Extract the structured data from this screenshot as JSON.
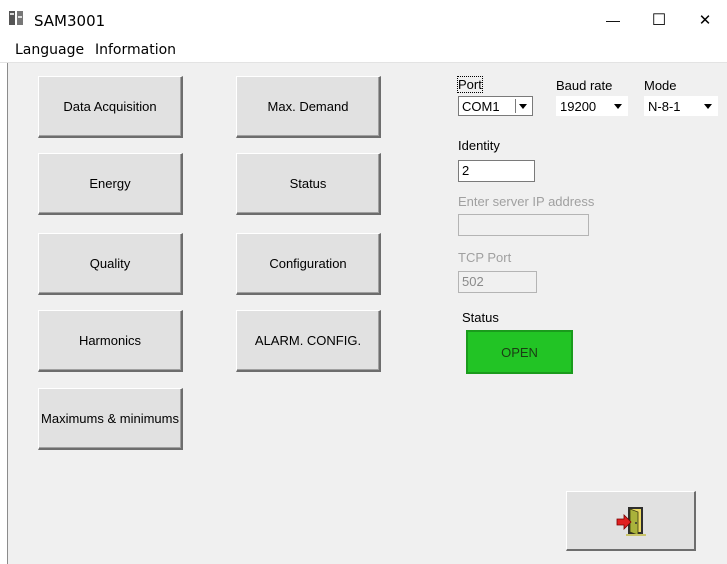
{
  "window": {
    "title": "SAM3001",
    "minimize_glyph": "—",
    "maximize_glyph": "☐",
    "close_glyph": "✕"
  },
  "menu": {
    "items": [
      {
        "label": "Language"
      },
      {
        "label": "Information"
      }
    ]
  },
  "buttons": {
    "left_column": [
      {
        "label": "Data Acquisition"
      },
      {
        "label": "Energy"
      },
      {
        "label": "Quality"
      },
      {
        "label": "Harmonics"
      },
      {
        "label": "Maximums & minimums"
      }
    ],
    "middle_column": [
      {
        "label": "Max. Demand"
      },
      {
        "label": "Status"
      },
      {
        "label": "Configuration"
      },
      {
        "label": "ALARM. CONFIG."
      }
    ],
    "exit_icon": "exit-door-icon"
  },
  "connection": {
    "port_label": "Port",
    "port_value": "COM1",
    "baud_label": "Baud rate",
    "baud_value": "19200",
    "mode_label": "Mode",
    "mode_value": "N-8-1",
    "identity_label": "Identity",
    "identity_value": "2",
    "ip_label": "Enter server IP address",
    "ip_value": "",
    "tcp_label": "TCP Port",
    "tcp_value": "502",
    "status_label": "Status",
    "status_value": "OPEN"
  },
  "colors": {
    "status_open": "#22c425",
    "window_bg": "#f0f0f0"
  }
}
